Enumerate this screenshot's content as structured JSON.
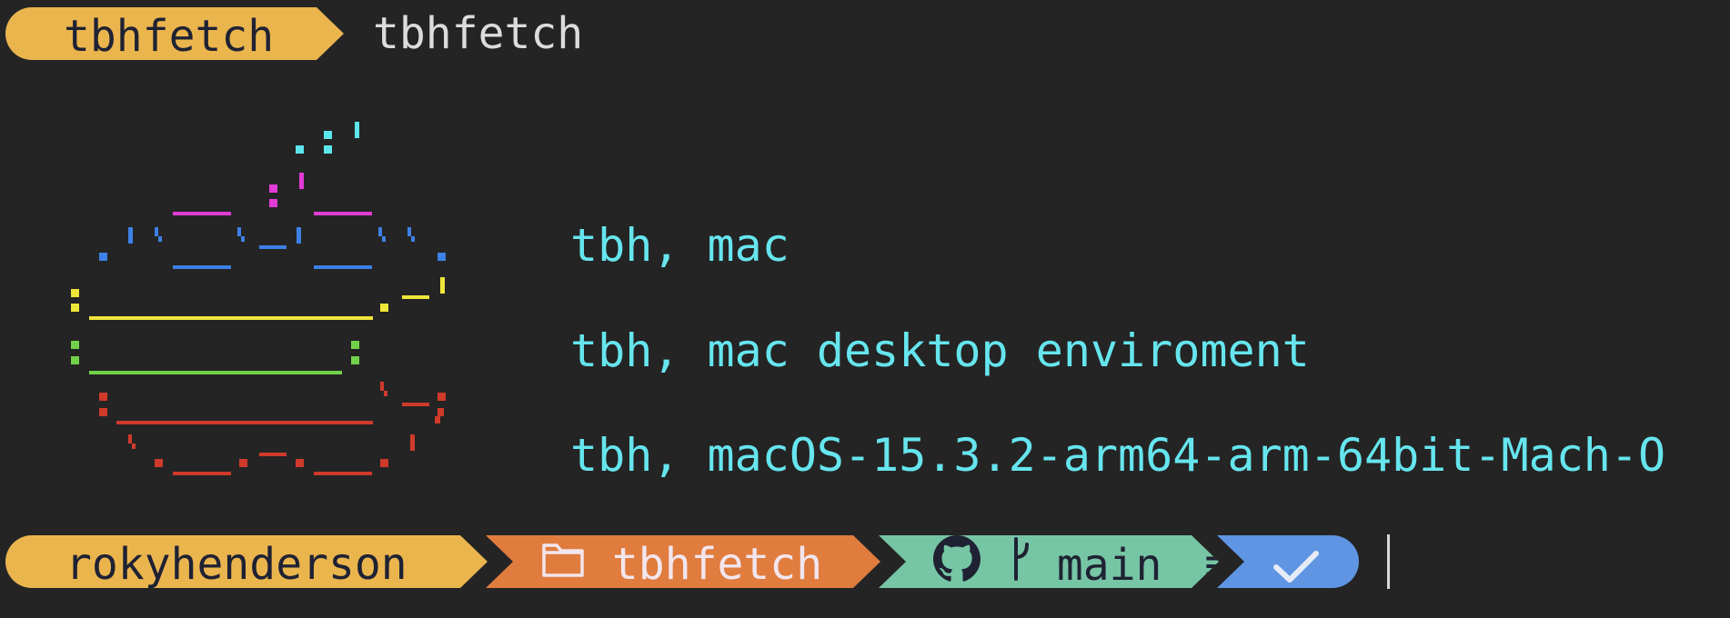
{
  "prompt_top": {
    "directory": "tbhfetch",
    "command": "tbhfetch"
  },
  "info": {
    "line1": "tbh, mac",
    "line2": "tbh, mac desktop enviroment",
    "line3": "tbh, macOS-15.3.2-arm64-arm-64bit-Mach-O"
  },
  "prompt_bottom": {
    "user": "rokyhenderson",
    "folder": "tbhfetch",
    "branch": "main",
    "branch_status": "≡",
    "status_icon": "check-icon"
  },
  "colors": {
    "background": "#242424",
    "segment_user": "#ebb54e",
    "segment_folder": "#e07c3e",
    "segment_git": "#76c5a5",
    "segment_status": "#5f95e3",
    "info_text": "#66e5ee",
    "ascii_cyan": "#5ce6ee",
    "ascii_magenta": "#e23bd6",
    "ascii_blue": "#3d80e6",
    "ascii_yellow": "#efe63a",
    "ascii_green": "#71d24a",
    "ascii_red": "#d03a2b"
  }
}
